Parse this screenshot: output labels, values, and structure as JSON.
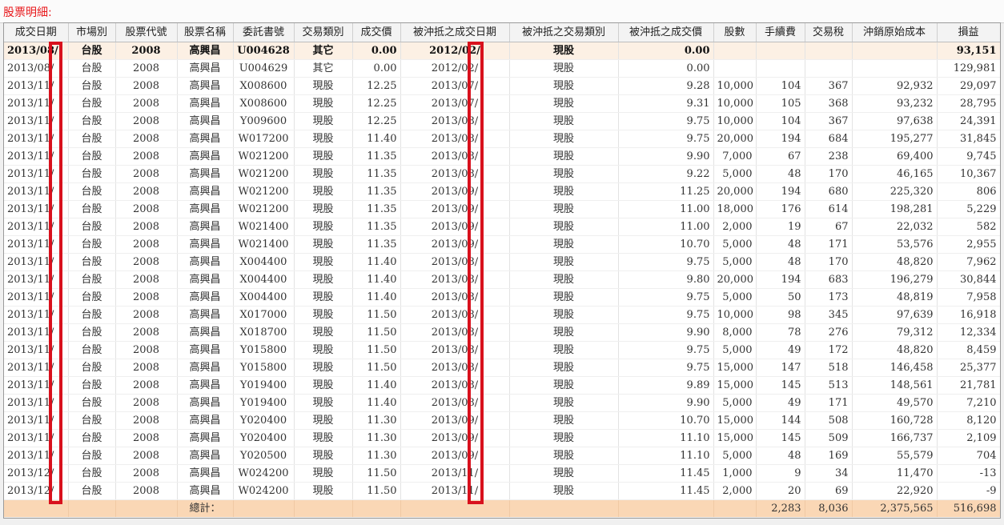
{
  "title": "股票明細:",
  "columns": [
    "成交日期",
    "市場別",
    "股票代號",
    "股票名稱",
    "委託書號",
    "交易類別",
    "成交價",
    "被沖抵之成交日期",
    "被沖抵之交易類別",
    "被沖抵之成交價",
    "股數",
    "手續費",
    "交易稅",
    "沖銷原始成本",
    "損益"
  ],
  "rows": [
    [
      "2013/08/",
      "台股",
      "2008",
      "高興昌",
      "U004628",
      "其它",
      "0.00",
      "2012/02/",
      "現股",
      "0.00",
      "",
      "",
      "",
      "",
      "93,151"
    ],
    [
      "2013/08/",
      "台股",
      "2008",
      "高興昌",
      "U004629",
      "其它",
      "0.00",
      "2012/02/",
      "現股",
      "0.00",
      "",
      "",
      "",
      "",
      "129,981"
    ],
    [
      "2013/11/",
      "台股",
      "2008",
      "高興昌",
      "X008600",
      "現股",
      "12.25",
      "2013/07/",
      "現股",
      "9.28",
      "10,000",
      "104",
      "367",
      "92,932",
      "29,097"
    ],
    [
      "2013/11/",
      "台股",
      "2008",
      "高興昌",
      "X008600",
      "現股",
      "12.25",
      "2013/07/",
      "現股",
      "9.31",
      "10,000",
      "105",
      "368",
      "93,232",
      "28,795"
    ],
    [
      "2013/11/",
      "台股",
      "2008",
      "高興昌",
      "Y009600",
      "現股",
      "12.25",
      "2013/08/",
      "現股",
      "9.75",
      "10,000",
      "104",
      "367",
      "97,638",
      "24,391"
    ],
    [
      "2013/11/",
      "台股",
      "2008",
      "高興昌",
      "W017200",
      "現股",
      "11.40",
      "2013/08/",
      "現股",
      "9.75",
      "20,000",
      "194",
      "684",
      "195,277",
      "31,845"
    ],
    [
      "2013/11/",
      "台股",
      "2008",
      "高興昌",
      "W021200",
      "現股",
      "11.35",
      "2013/08/",
      "現股",
      "9.90",
      "7,000",
      "67",
      "238",
      "69,400",
      "9,745"
    ],
    [
      "2013/11/",
      "台股",
      "2008",
      "高興昌",
      "W021200",
      "現股",
      "11.35",
      "2013/08/",
      "現股",
      "9.22",
      "5,000",
      "48",
      "170",
      "46,165",
      "10,367"
    ],
    [
      "2013/11/",
      "台股",
      "2008",
      "高興昌",
      "W021200",
      "現股",
      "11.35",
      "2013/09/",
      "現股",
      "11.25",
      "20,000",
      "194",
      "680",
      "225,320",
      "806"
    ],
    [
      "2013/11/",
      "台股",
      "2008",
      "高興昌",
      "W021200",
      "現股",
      "11.35",
      "2013/09/",
      "現股",
      "11.00",
      "18,000",
      "176",
      "614",
      "198,281",
      "5,229"
    ],
    [
      "2013/11/",
      "台股",
      "2008",
      "高興昌",
      "W021400",
      "現股",
      "11.35",
      "2013/09/",
      "現股",
      "11.00",
      "2,000",
      "19",
      "67",
      "22,032",
      "582"
    ],
    [
      "2013/11/",
      "台股",
      "2008",
      "高興昌",
      "W021400",
      "現股",
      "11.35",
      "2013/09/",
      "現股",
      "10.70",
      "5,000",
      "48",
      "171",
      "53,576",
      "2,955"
    ],
    [
      "2013/11/",
      "台股",
      "2008",
      "高興昌",
      "X004400",
      "現股",
      "11.40",
      "2013/08/",
      "現股",
      "9.75",
      "5,000",
      "48",
      "170",
      "48,820",
      "7,962"
    ],
    [
      "2013/11/",
      "台股",
      "2008",
      "高興昌",
      "X004400",
      "現股",
      "11.40",
      "2013/08/",
      "現股",
      "9.80",
      "20,000",
      "194",
      "683",
      "196,279",
      "30,844"
    ],
    [
      "2013/11/",
      "台股",
      "2008",
      "高興昌",
      "X004400",
      "現股",
      "11.40",
      "2013/08/",
      "現股",
      "9.75",
      "5,000",
      "50",
      "173",
      "48,819",
      "7,958"
    ],
    [
      "2013/11/",
      "台股",
      "2008",
      "高興昌",
      "X017000",
      "現股",
      "11.50",
      "2013/08/",
      "現股",
      "9.75",
      "10,000",
      "98",
      "345",
      "97,639",
      "16,918"
    ],
    [
      "2013/11/",
      "台股",
      "2008",
      "高興昌",
      "X018700",
      "現股",
      "11.50",
      "2013/08/",
      "現股",
      "9.90",
      "8,000",
      "78",
      "276",
      "79,312",
      "12,334"
    ],
    [
      "2013/11/",
      "台股",
      "2008",
      "高興昌",
      "Y015800",
      "現股",
      "11.50",
      "2013/08/",
      "現股",
      "9.75",
      "5,000",
      "49",
      "172",
      "48,820",
      "8,459"
    ],
    [
      "2013/11/",
      "台股",
      "2008",
      "高興昌",
      "Y015800",
      "現股",
      "11.50",
      "2013/08/",
      "現股",
      "9.75",
      "15,000",
      "147",
      "518",
      "146,458",
      "25,377"
    ],
    [
      "2013/11/",
      "台股",
      "2008",
      "高興昌",
      "Y019400",
      "現股",
      "11.40",
      "2013/08/",
      "現股",
      "9.89",
      "15,000",
      "145",
      "513",
      "148,561",
      "21,781"
    ],
    [
      "2013/11/",
      "台股",
      "2008",
      "高興昌",
      "Y019400",
      "現股",
      "11.40",
      "2013/08/",
      "現股",
      "9.90",
      "5,000",
      "49",
      "171",
      "49,570",
      "7,210"
    ],
    [
      "2013/11/",
      "台股",
      "2008",
      "高興昌",
      "Y020400",
      "現股",
      "11.30",
      "2013/09/",
      "現股",
      "10.70",
      "15,000",
      "144",
      "508",
      "160,728",
      "8,120"
    ],
    [
      "2013/11/",
      "台股",
      "2008",
      "高興昌",
      "Y020400",
      "現股",
      "11.30",
      "2013/09/",
      "現股",
      "11.10",
      "15,000",
      "145",
      "509",
      "166,737",
      "2,109"
    ],
    [
      "2013/11/",
      "台股",
      "2008",
      "高興昌",
      "Y020500",
      "現股",
      "11.30",
      "2013/09/",
      "現股",
      "11.10",
      "5,000",
      "48",
      "169",
      "55,579",
      "704"
    ],
    [
      "2013/12/",
      "台股",
      "2008",
      "高興昌",
      "W024200",
      "現股",
      "11.50",
      "2013/11/",
      "現股",
      "11.45",
      "1,000",
      "9",
      "34",
      "11,470",
      "-13"
    ],
    [
      "2013/12/",
      "台股",
      "2008",
      "高興昌",
      "W024200",
      "現股",
      "11.50",
      "2013/11/",
      "現股",
      "11.45",
      "2,000",
      "20",
      "69",
      "22,920",
      "-9"
    ]
  ],
  "total": {
    "label": "總計：",
    "fee": "2,283",
    "tax": "8,036",
    "cost": "2,375,565",
    "pnl": "516,698"
  }
}
